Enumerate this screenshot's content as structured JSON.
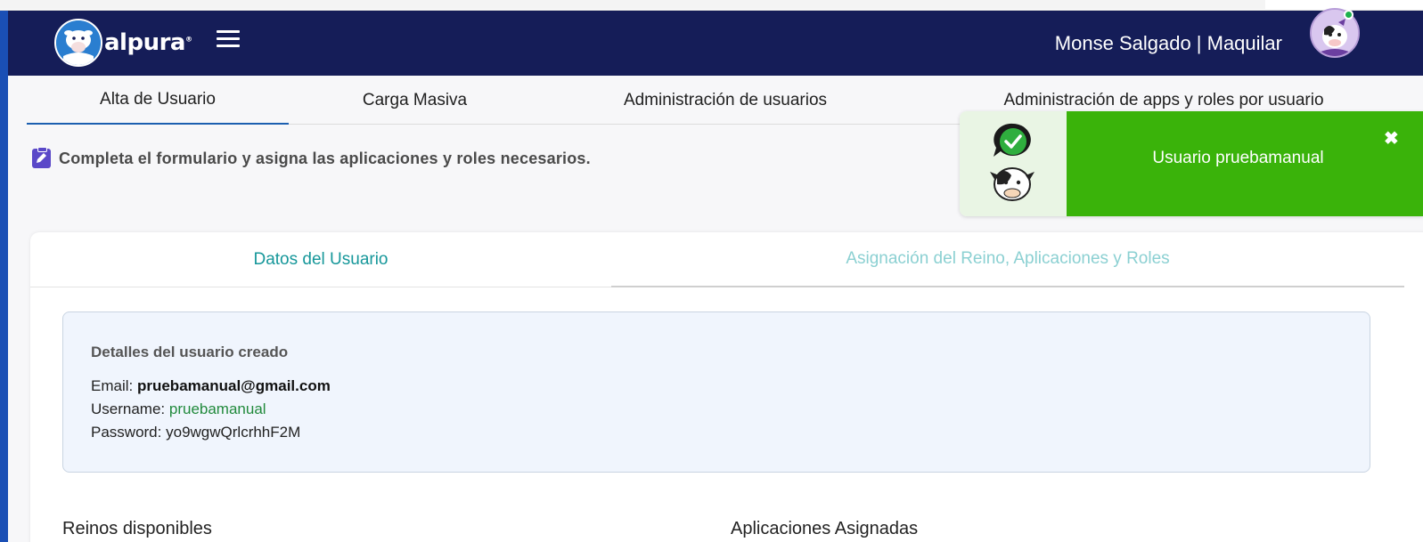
{
  "header": {
    "logo_text": "alpura",
    "logo_mark": "®",
    "user": "Monse Salgado | Maquilar",
    "menu_icon": "hamburger-icon",
    "avatar_icon": "cow-avatar-icon"
  },
  "tabs": [
    {
      "label": "Alta de Usuario",
      "active": true
    },
    {
      "label": "Carga Masiva",
      "active": false
    },
    {
      "label": "Administración de usuarios",
      "active": false
    },
    {
      "label": "Administración de apps y roles por usuario",
      "active": false
    }
  ],
  "instructions": {
    "icon": "clipboard-edit-icon",
    "text": "Completa el formulario y asigna las aplicaciones y roles necesarios."
  },
  "form_tabs": [
    {
      "label": "Datos del Usuario",
      "active": true
    },
    {
      "label": "Asignación del Reino, Aplicaciones y Roles",
      "active": false
    }
  ],
  "details": {
    "title": "Detalles del usuario creado",
    "email_label": "Email:",
    "email": "pruebamanual@gmail.com",
    "username_label": "Username:",
    "username": "pruebamanual",
    "password_label": "Password:",
    "password": "yo9wgwQrlcrhhF2M"
  },
  "sections": {
    "reinos_label": "Reinos disponibles",
    "apps_label": "Aplicaciones Asignadas"
  },
  "toast": {
    "message": "Usuario pruebamanual",
    "close": "✖",
    "icons": [
      "check-chat-icon",
      "cow-mascot-icon"
    ]
  },
  "colors": {
    "header_bg": "#151d58",
    "accent_blue": "#1c5fb0",
    "teal": "#16979a",
    "toast_green": "#3ab30a",
    "username_green": "#218a3c"
  }
}
